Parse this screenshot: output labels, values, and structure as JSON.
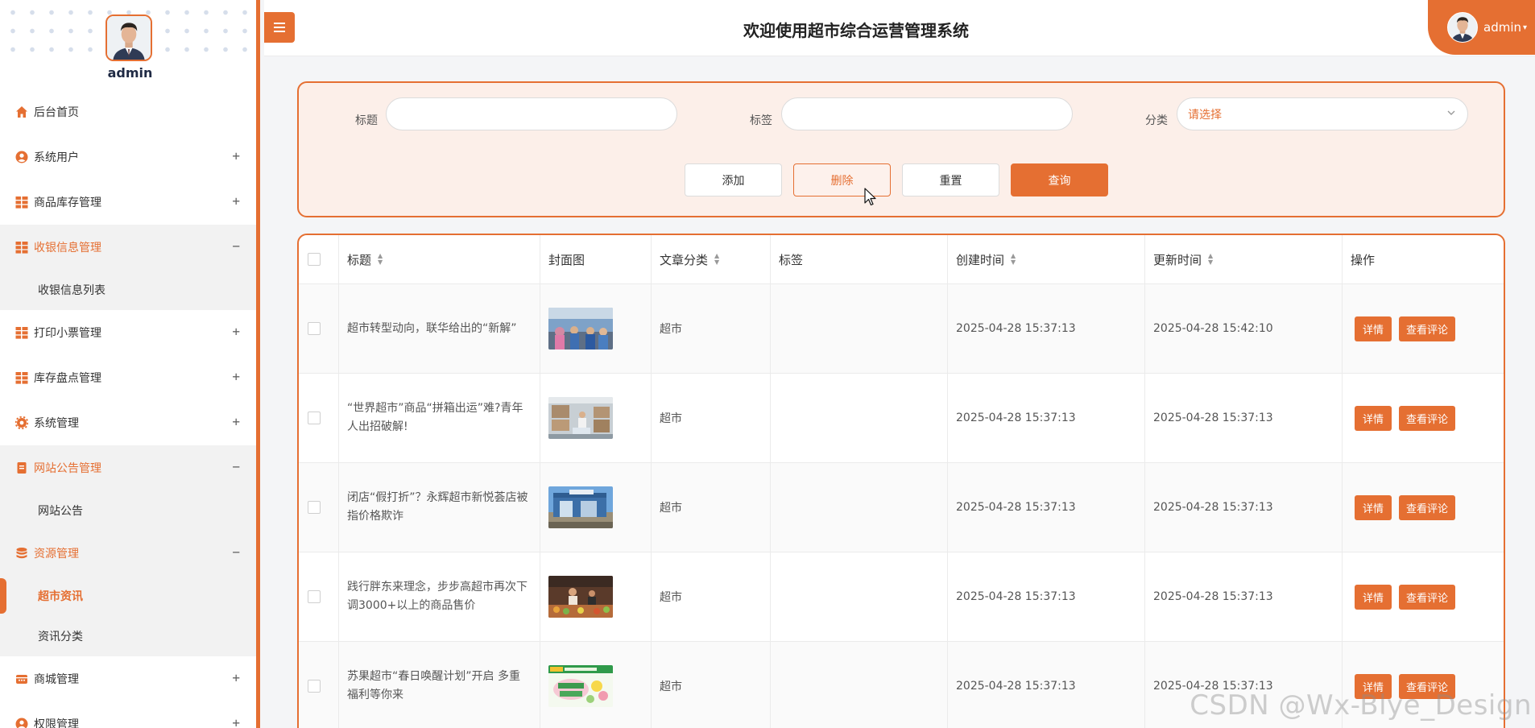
{
  "app": {
    "title": "欢迎使用超市综合运营管理系统"
  },
  "colors": {
    "accent": "#e56f32",
    "accent_light": "#fcefe9"
  },
  "profile": {
    "name": "admin"
  },
  "header": {
    "user_name": "admin"
  },
  "sidebar": {
    "items": [
      {
        "label": "后台首页",
        "icon": "home-icon",
        "toggle": ""
      },
      {
        "label": "系统用户",
        "icon": "user-icon",
        "toggle": "+"
      },
      {
        "label": "商品库存管理",
        "icon": "grid-icon",
        "toggle": "+"
      },
      {
        "label": "收银信息管理",
        "icon": "grid-icon",
        "toggle": "−",
        "children": [
          "收银信息列表"
        ]
      },
      {
        "label": "打印小票管理",
        "icon": "grid-icon",
        "toggle": "+"
      },
      {
        "label": "库存盘点管理",
        "icon": "grid-icon",
        "toggle": "+"
      },
      {
        "label": "系统管理",
        "icon": "gear-icon",
        "toggle": "+"
      },
      {
        "label": "网站公告管理",
        "icon": "document-icon",
        "toggle": "−",
        "children": [
          "网站公告"
        ]
      },
      {
        "label": "资源管理",
        "icon": "database-icon",
        "toggle": "−",
        "children": [
          "超市资讯",
          "资讯分类"
        ]
      },
      {
        "label": "商城管理",
        "icon": "store-icon",
        "toggle": "+"
      },
      {
        "label": "权限管理",
        "icon": "user-icon",
        "toggle": "+"
      }
    ],
    "active_child": "超市资讯"
  },
  "search": {
    "title_label": "标题",
    "tag_label": "标签",
    "category_label": "分类",
    "category_placeholder": "请选择",
    "buttons": {
      "add": "添加",
      "delete": "删除",
      "reset": "重置",
      "query": "查询"
    }
  },
  "table": {
    "columns": [
      "标题",
      "封面图",
      "文章分类",
      "标签",
      "创建时间",
      "更新时间",
      "操作"
    ],
    "action_labels": {
      "detail": "详情",
      "comments": "查看评论"
    },
    "rows": [
      {
        "title": "超市转型动向，联华给出的“新解”",
        "category": "超市",
        "tags": "",
        "created": "2025-04-28 15:37:13",
        "updated": "2025-04-28 15:42:10"
      },
      {
        "title": "“世界超市”商品“拼箱出运”难?青年人出招破解!",
        "category": "超市",
        "tags": "",
        "created": "2025-04-28 15:37:13",
        "updated": "2025-04-28 15:37:13"
      },
      {
        "title": "闭店“假打折”？永辉超市新悦荟店被指价格欺诈",
        "category": "超市",
        "tags": "",
        "created": "2025-04-28 15:37:13",
        "updated": "2025-04-28 15:37:13"
      },
      {
        "title": "践行胖东来理念，步步高超市再次下调3000+以上的商品售价",
        "category": "超市",
        "tags": "",
        "created": "2025-04-28 15:37:13",
        "updated": "2025-04-28 15:37:13"
      },
      {
        "title": "苏果超市“春日唤醒计划”开启 多重福利等你来",
        "category": "超市",
        "tags": "",
        "created": "2025-04-28 15:37:13",
        "updated": "2025-04-28 15:37:13"
      }
    ]
  },
  "watermark": "CSDN @Wx-Blye_Design"
}
